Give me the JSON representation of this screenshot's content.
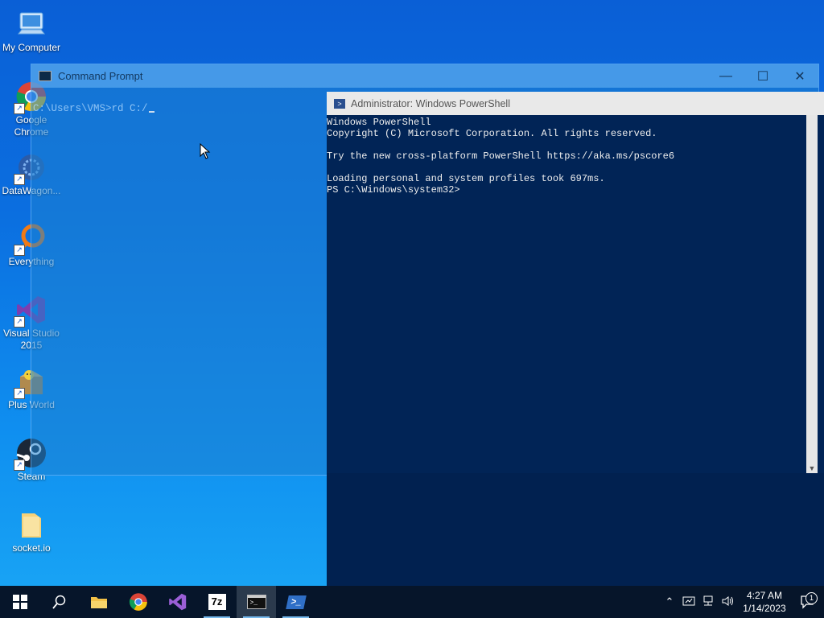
{
  "desktop": {
    "icons": [
      {
        "label": "My Computer",
        "icon": "computer-icon"
      },
      {
        "label": "Google Chrome",
        "icon": "chrome-icon"
      },
      {
        "label": "DataWagon...",
        "icon": "datawagon-icon"
      },
      {
        "label": "Everything",
        "icon": "everything-icon"
      },
      {
        "label": "Visual Studio 2015",
        "icon": "visual-studio-icon"
      },
      {
        "label": "Plus World",
        "icon": "plus-world-icon"
      },
      {
        "label": "Steam",
        "icon": "steam-icon"
      },
      {
        "label": "socket.io",
        "icon": "folder-icon"
      }
    ]
  },
  "cmd_window": {
    "title": "Command Prompt",
    "prompt_line": "C:\\Users\\VMS>rd C:/",
    "minimize": "—",
    "maximize": "☐",
    "close": "✕"
  },
  "powershell_window": {
    "title": "Administrator: Windows PowerShell",
    "lines": [
      "Windows PowerShell",
      "Copyright (C) Microsoft Corporation. All rights reserved.",
      "",
      "Try the new cross-platform PowerShell https://aka.ms/pscore6",
      "",
      "Loading personal and system profiles took 697ms.",
      "PS C:\\Windows\\system32>"
    ]
  },
  "taskbar": {
    "items": [
      "start-icon",
      "search-icon",
      "file-explorer-icon",
      "chrome-icon",
      "visual-studio-icon",
      "7zip-icon",
      "cmd-icon",
      "powershell-icon"
    ],
    "sevenzip_label": "7z",
    "clock_time": "4:27 AM",
    "clock_date": "1/14/2023",
    "notification_count": "1"
  },
  "colors": {
    "ps_background": "#012456",
    "taskbar": "#06152a",
    "accent": "#76b9ed"
  }
}
